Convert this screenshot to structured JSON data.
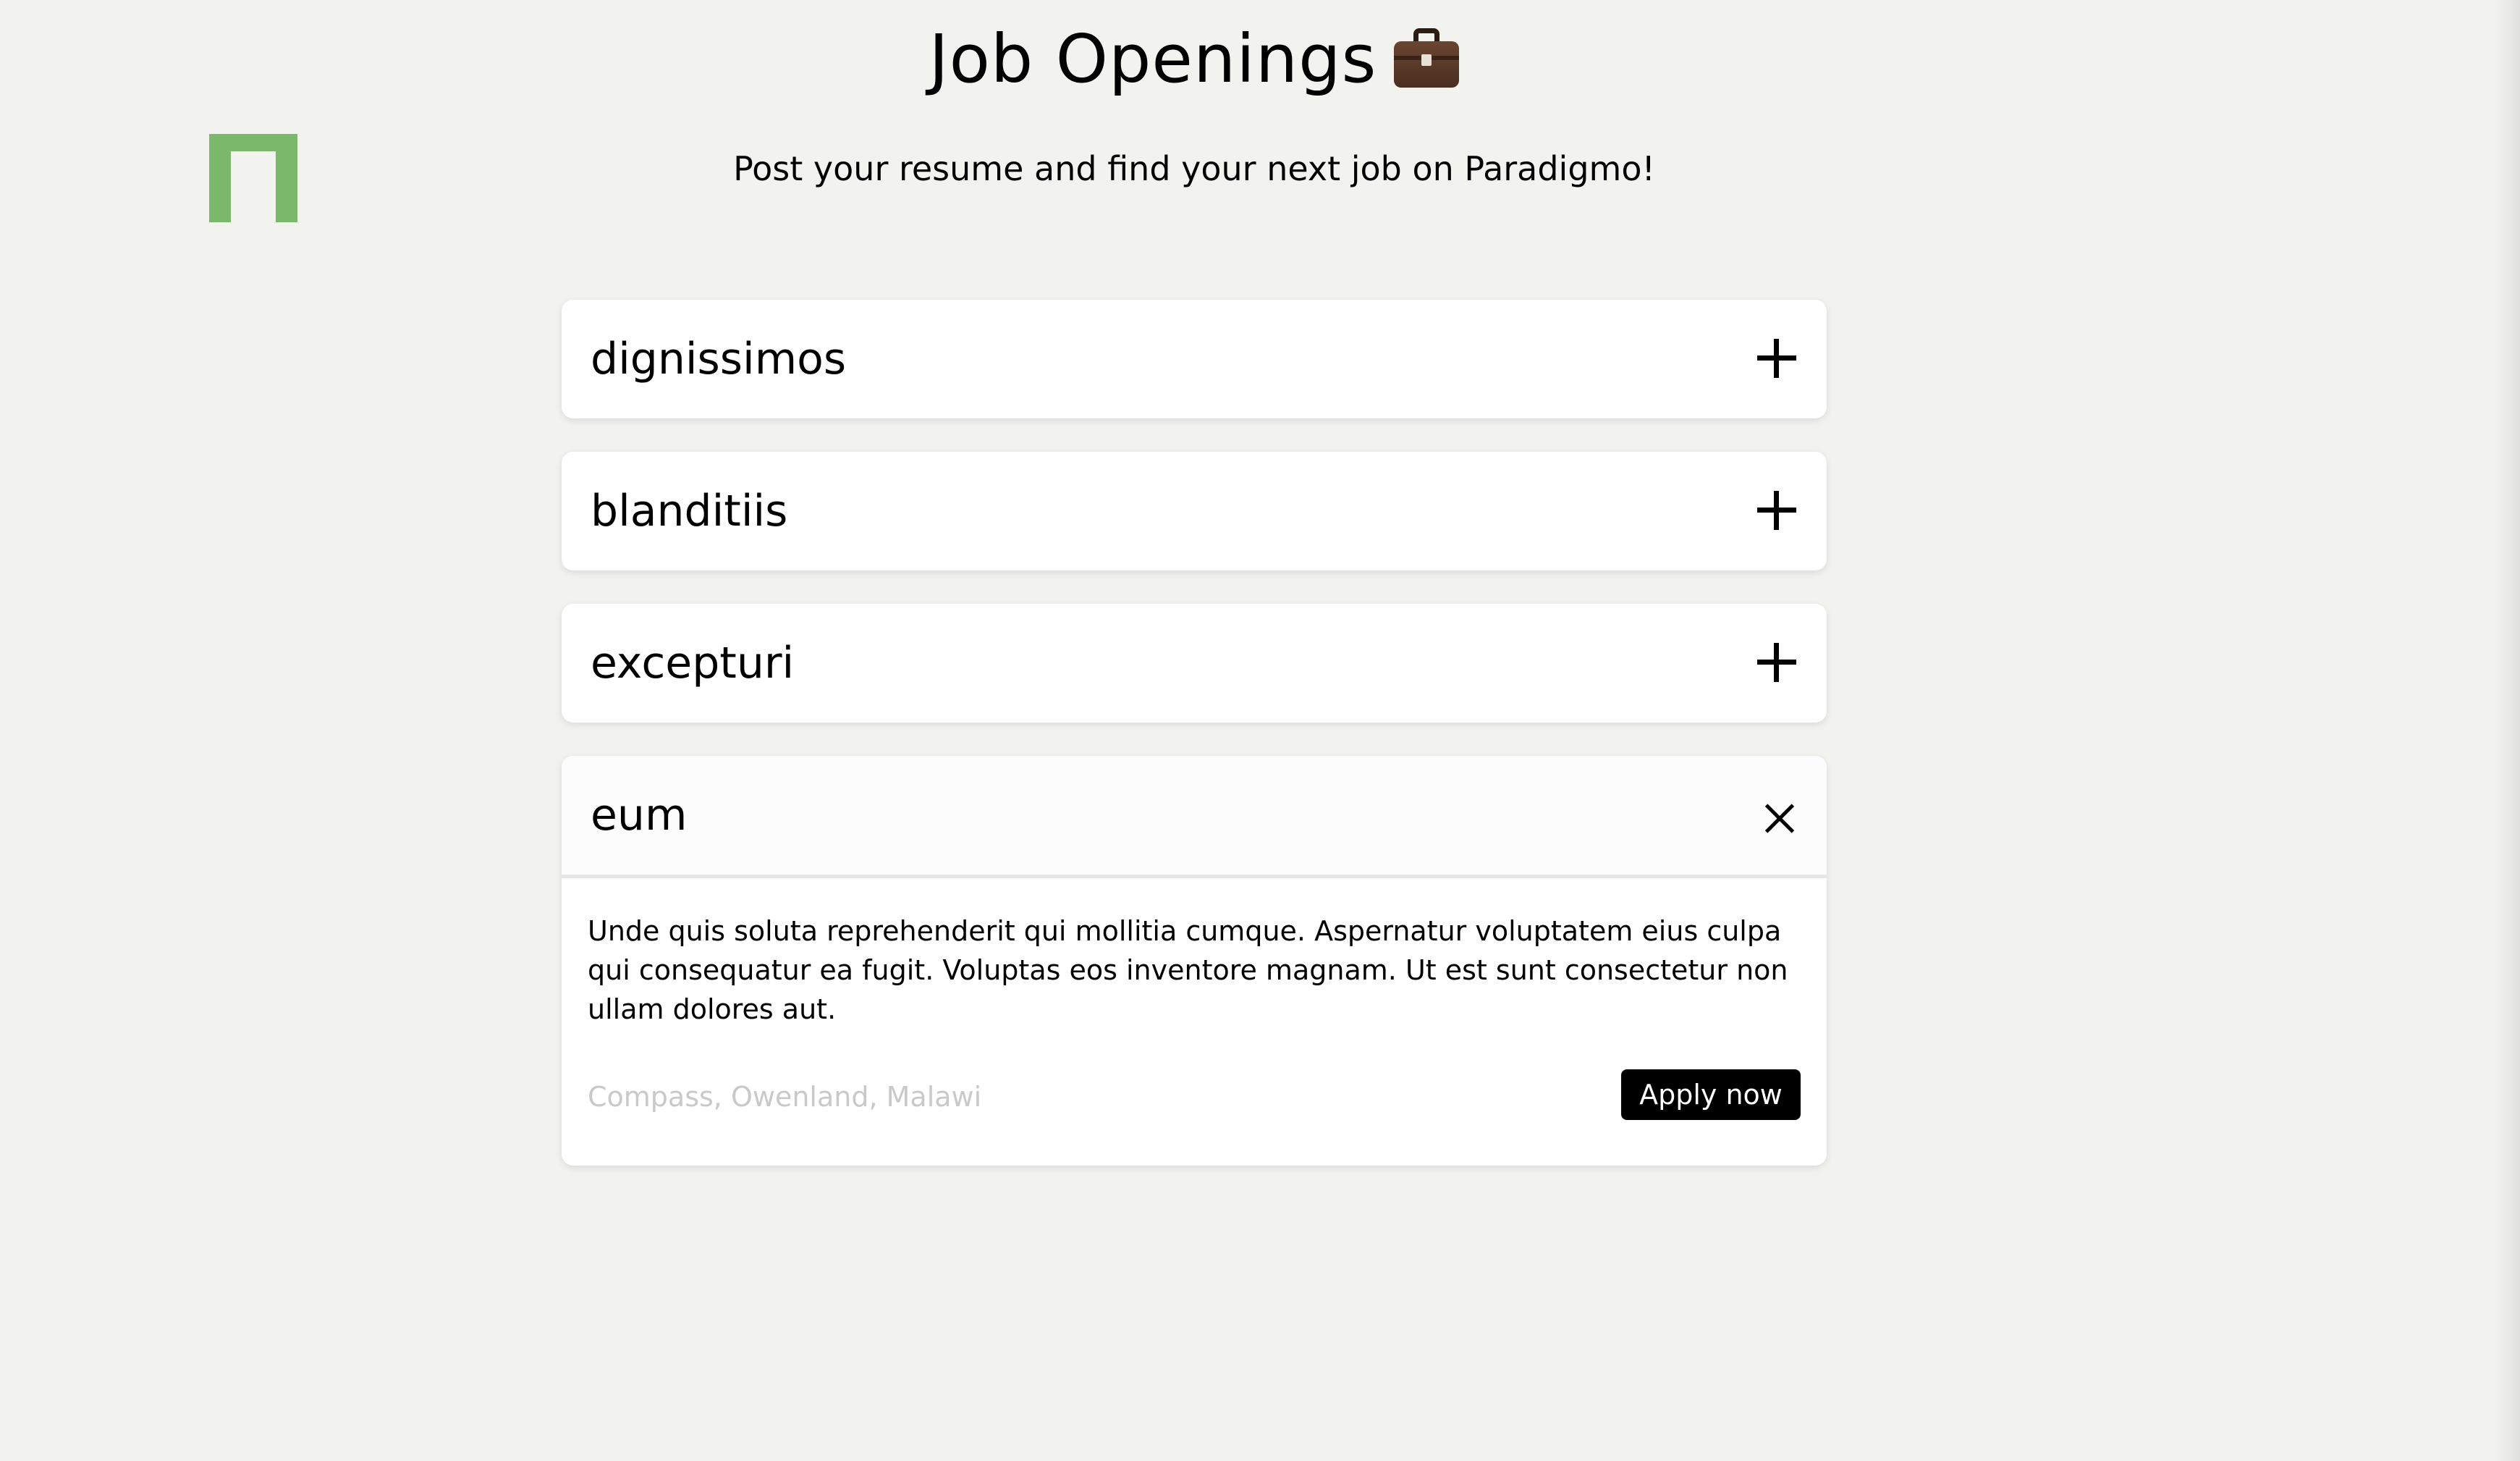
{
  "header": {
    "title": "Job Openings",
    "subtitle": "Post your resume and find your next job on Paradigmo!",
    "title_icon": "briefcase-icon",
    "logo_color": "#7bb86c"
  },
  "jobs": [
    {
      "title": "dignissimos",
      "state": "collapsed",
      "toggle_icon": "plus-icon"
    },
    {
      "title": "blanditiis",
      "state": "collapsed",
      "toggle_icon": "plus-icon"
    },
    {
      "title": "excepturi",
      "state": "collapsed",
      "toggle_icon": "plus-icon"
    },
    {
      "title": "eum",
      "state": "expanded",
      "toggle_icon": "close-icon",
      "description": "Unde quis soluta reprehenderit qui mollitia cumque. Aspernatur voluptatem eius culpa qui consequatur ea fugit. Voluptas eos inventore magnam. Ut est sunt consectetur non ullam dolores aut.",
      "location": "Compass, Owenland, Malawi",
      "apply_label": "Apply now"
    }
  ],
  "colors": {
    "background": "#f2f2ef",
    "card": "#ffffff",
    "button": "#000000",
    "location_text": "#c9c9c9"
  }
}
